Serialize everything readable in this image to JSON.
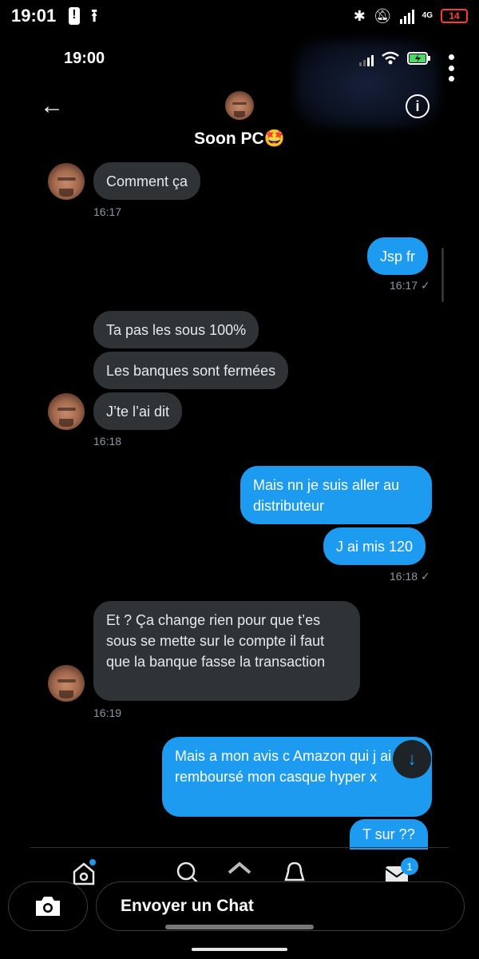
{
  "status_bar": {
    "time": "19:01",
    "network": "4G",
    "battery": "14"
  },
  "inner_status": {
    "time": "19:00"
  },
  "header": {
    "back_icon": "arrow-left-icon",
    "title": "Soon PC🤩",
    "info_icon": "info-icon"
  },
  "messages": [
    {
      "dir": "in",
      "text": "Comment ça"
    },
    {
      "dir": "in_time",
      "text": "16:17"
    },
    {
      "dir": "out",
      "text": "Jsp fr"
    },
    {
      "dir": "out_time",
      "text": "16:17"
    },
    {
      "dir": "in",
      "text": "Ta pas les sous 100%"
    },
    {
      "dir": "in",
      "text": "Les banques sont fermées"
    },
    {
      "dir": "in",
      "text": "J’te l’ai dit"
    },
    {
      "dir": "in_time",
      "text": "16:18"
    },
    {
      "dir": "out",
      "text": "Mais nn je suis aller au distributeur"
    },
    {
      "dir": "out",
      "text": "J ai mis 120"
    },
    {
      "dir": "out_time",
      "text": "16:18"
    },
    {
      "dir": "in",
      "text": "Et ? Ça change rien pour que t’es sous se mette sur le compte il faut que la banque fasse la transaction"
    },
    {
      "dir": "in_time",
      "text": "16:19"
    },
    {
      "dir": "out",
      "text": "Mais a mon avis c Amazon qui j ai remboursé mon casque hyper x"
    },
    {
      "dir": "out",
      "text": "T sur ??"
    }
  ],
  "inner_nav": {
    "items": [
      "home-icon",
      "search-icon",
      "notifications-icon",
      "messages-icon"
    ],
    "messages_badge": "1"
  },
  "composer": {
    "placeholder": "Envoyer un Chat",
    "camera_icon": "camera-icon"
  },
  "colors": {
    "out_bubble": "#1d9bf0",
    "in_bubble": "#2f3336",
    "background": "#000000"
  }
}
